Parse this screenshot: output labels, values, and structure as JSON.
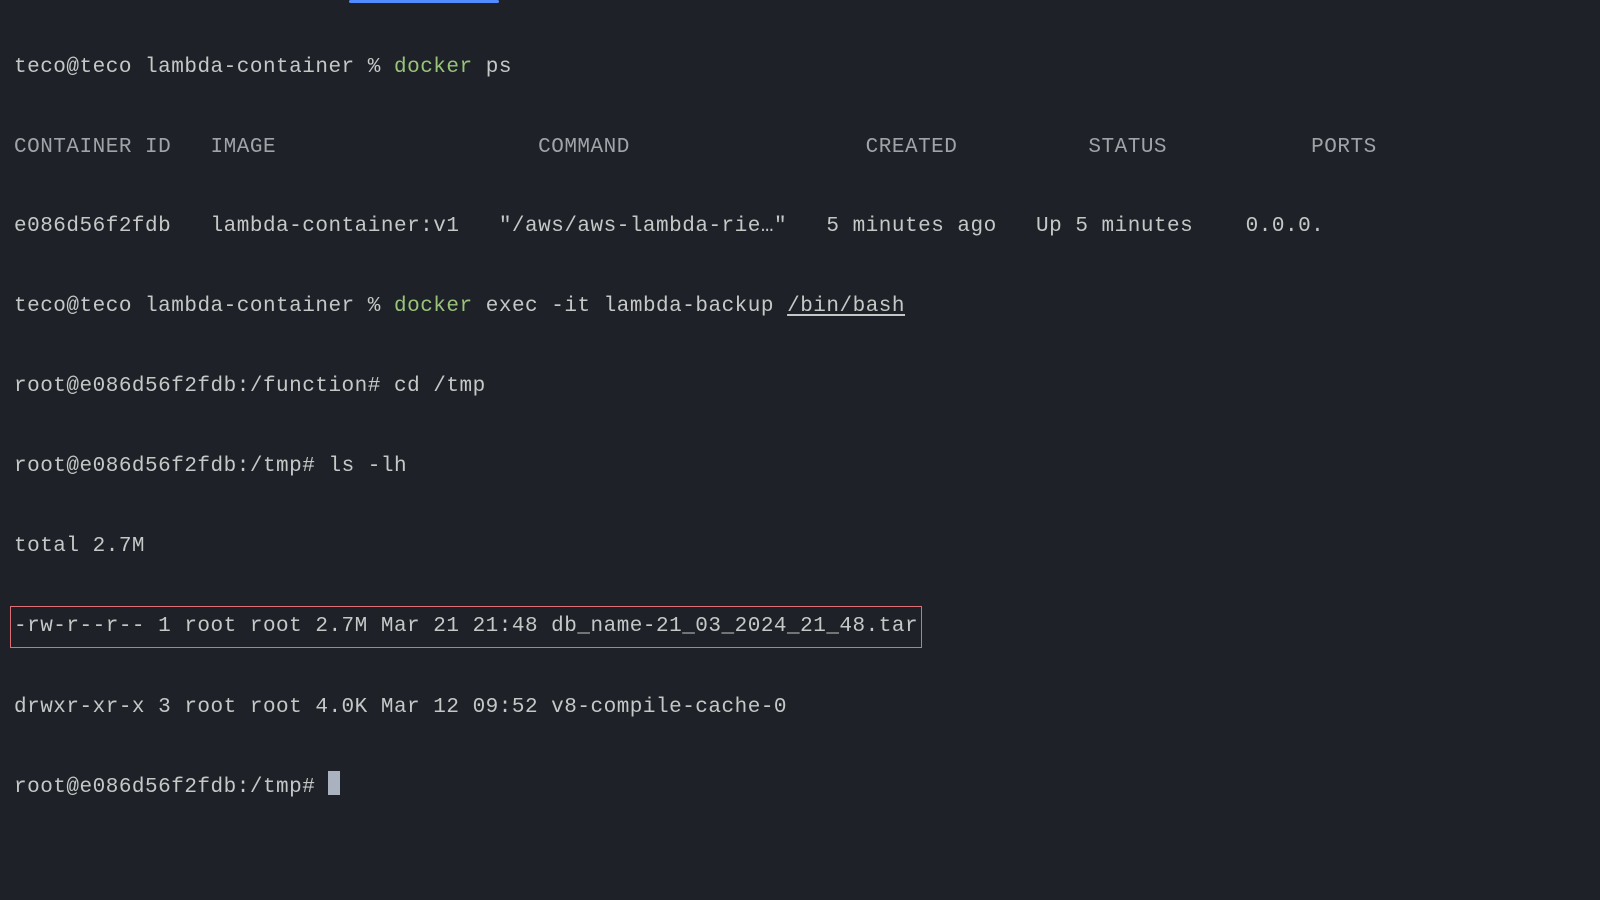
{
  "accent_color": "#528bff",
  "prompt1": {
    "user_host": "teco@teco",
    "dir": "lambda-container",
    "symbol": "%",
    "cmd": "docker",
    "args": "ps"
  },
  "ps_header": {
    "container_id": "CONTAINER ID",
    "image": "IMAGE",
    "command": "COMMAND",
    "created": "CREATED",
    "status": "STATUS",
    "ports": "PORTS"
  },
  "ps_row": {
    "container_id": "e086d56f2fdb",
    "image": "lambda-container:v1",
    "command": "\"/aws/aws-lambda-rie…\"",
    "created": "5 minutes ago",
    "status": "Up 5 minutes",
    "ports": "0.0.0."
  },
  "prompt2": {
    "user_host": "teco@teco",
    "dir": "lambda-container",
    "symbol": "%",
    "cmd": "docker",
    "args_pre": "exec -it lambda-backup ",
    "args_underline": "/bin/bash"
  },
  "line_cd": {
    "prompt": "root@e086d56f2fdb:/function#",
    "cmd": "cd /tmp"
  },
  "line_ls": {
    "prompt": "root@e086d56f2fdb:/tmp#",
    "cmd": "ls -lh"
  },
  "total_line": "total 2.7M",
  "file1": "-rw-r--r-- 1 root root 2.7M Mar 21 21:48 db_name-21_03_2024_21_48.tar",
  "file2": "drwxr-xr-x 3 root root 4.0K Mar 12 09:52 v8-compile-cache-0",
  "prompt3": "root@e086d56f2fdb:/tmp# "
}
